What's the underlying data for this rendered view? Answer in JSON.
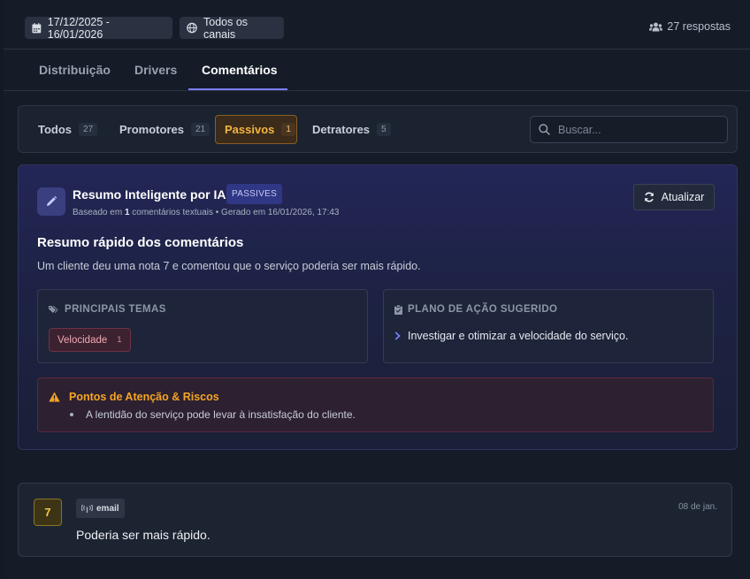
{
  "header": {
    "date_range": "17/12/2025 - 16/01/2026",
    "channel_filter": "Todos os canais",
    "responses": "27 respostas"
  },
  "tabs": [
    {
      "label": "Distribuição"
    },
    {
      "label": "Drivers"
    },
    {
      "label": "Comentários"
    }
  ],
  "filters": {
    "todos": {
      "label": "Todos",
      "count": "27"
    },
    "promotores": {
      "label": "Promotores",
      "count": "21"
    },
    "passivos": {
      "label": "Passivos",
      "count": "1"
    },
    "detratores": {
      "label": "Detratores",
      "count": "5"
    },
    "search_placeholder": "Buscar..."
  },
  "ai_summary": {
    "title": "Resumo Inteligente por IA",
    "badge": "PASSIVES",
    "meta_prefix": "Baseado em ",
    "meta_count": "1",
    "meta_suffix": " comentários textuais • Gerado em 16/01/2026, 17:43",
    "refresh_label": "Atualizar",
    "heading": "Resumo rápido dos comentários",
    "text": "Um cliente deu uma nota 7 e comentou que o serviço poderia ser mais rápido.",
    "themes_label": "PRINCIPAIS TEMAS",
    "themes": [
      {
        "label": "Velocidade",
        "count": "1"
      }
    ],
    "plan_label": "PLANO DE AÇÃO SUGERIDO",
    "plan_items": [
      "Investigar e otimizar a velocidade do serviço."
    ],
    "risks_label": "Pontos de Atenção & Riscos",
    "risks": [
      "A lentidão do serviço pode levar à insatisfação do cliente."
    ]
  },
  "comments": [
    {
      "score": "7",
      "source": "email",
      "date": "08 de jan.",
      "text": "Poderia ser mais rápido."
    }
  ],
  "colors": {
    "accent": "#7c7ff0",
    "passive": "#f4b53f",
    "risk": "#f5a524",
    "theme_tag": "#f0a7b4"
  }
}
